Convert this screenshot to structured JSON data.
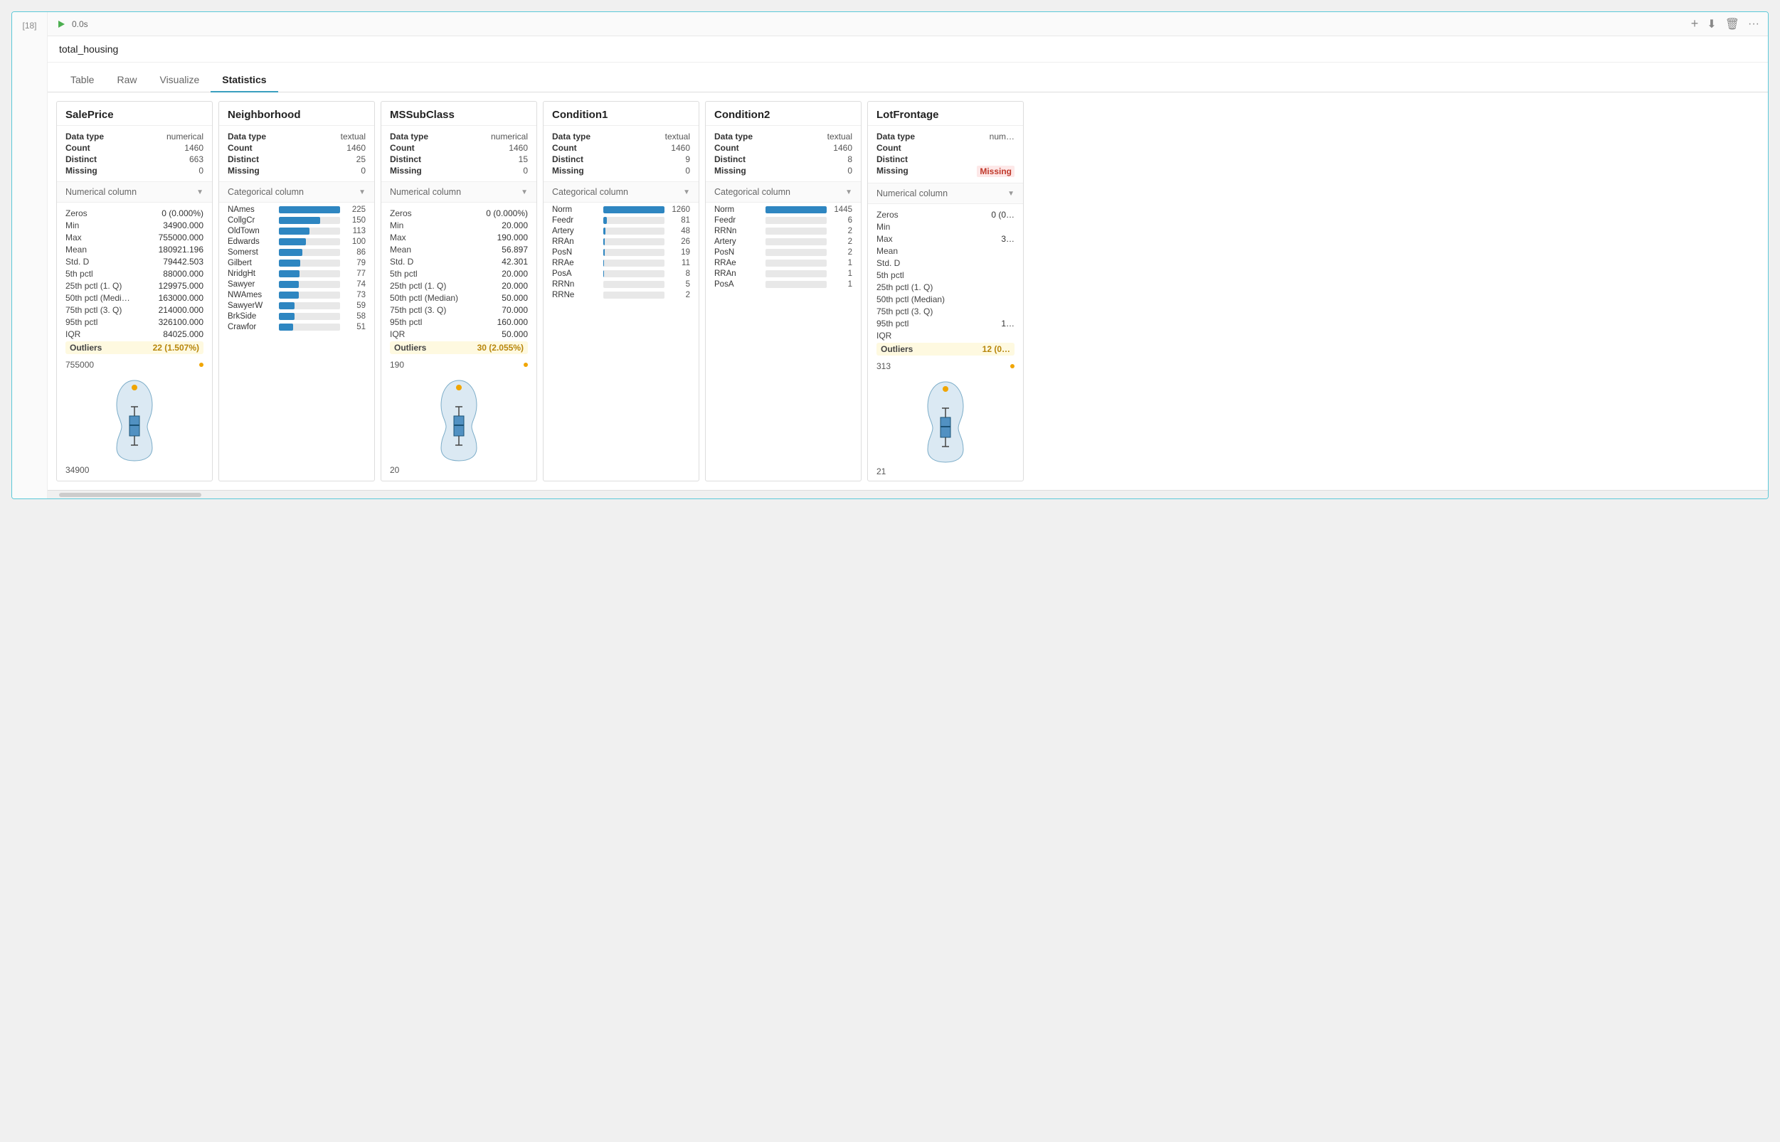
{
  "cell": {
    "number": "[18]",
    "run_time": "0.0s",
    "title": "total_housing",
    "actions": [
      "+",
      "⬇",
      "🗑",
      "···"
    ]
  },
  "tabs": [
    {
      "label": "Table",
      "active": false
    },
    {
      "label": "Raw",
      "active": false
    },
    {
      "label": "Visualize",
      "active": false
    },
    {
      "label": "Statistics",
      "active": true
    }
  ],
  "columns": [
    {
      "name": "SalePrice",
      "type": "numerical",
      "type_label": "Numerical column",
      "meta": {
        "Data type": "numerical",
        "Count": "1460",
        "Distinct": "663",
        "Missing": "0"
      },
      "stats": [
        {
          "label": "Zeros",
          "value": "0 (0.000%)"
        },
        {
          "label": "Min",
          "value": "34900.000"
        },
        {
          "label": "Max",
          "value": "755000.000"
        },
        {
          "label": "Mean",
          "value": "180921.196"
        },
        {
          "label": "Std. D",
          "value": "79442.503"
        },
        {
          "label": "5th pctl",
          "value": "88000.000"
        },
        {
          "label": "25th pctl (1. Q)",
          "value": "129975.000"
        },
        {
          "label": "50th pctl (Medi…",
          "value": "163000.000"
        },
        {
          "label": "75th pctl (3. Q)",
          "value": "214000.000"
        },
        {
          "label": "95th pctl",
          "value": "326100.000"
        },
        {
          "label": "IQR",
          "value": "84025.000"
        }
      ],
      "outliers": {
        "label": "Outliers",
        "value": "22 (1.507%)"
      },
      "violin_min": "34900",
      "violin_max": "755000",
      "missing_highlight": false
    },
    {
      "name": "Neighborhood",
      "type": "textual",
      "type_label": "Categorical column",
      "meta": {
        "Data type": "textual",
        "Count": "1460",
        "Distinct": "25",
        "Missing": "0"
      },
      "bars": [
        {
          "label": "NAmes",
          "count": 225,
          "max": 225
        },
        {
          "label": "CollgCr",
          "count": 150,
          "max": 225
        },
        {
          "label": "OldTown",
          "count": 113,
          "max": 225
        },
        {
          "label": "Edwards",
          "count": 100,
          "max": 225
        },
        {
          "label": "Somerst",
          "count": 86,
          "max": 225
        },
        {
          "label": "Gilbert",
          "count": 79,
          "max": 225
        },
        {
          "label": "NridgHt",
          "count": 77,
          "max": 225
        },
        {
          "label": "Sawyer",
          "count": 74,
          "max": 225
        },
        {
          "label": "NWAmes",
          "count": 73,
          "max": 225
        },
        {
          "label": "SawyerW",
          "count": 59,
          "max": 225
        },
        {
          "label": "BrkSide",
          "count": 58,
          "max": 225
        },
        {
          "label": "Crawfor",
          "count": 51,
          "max": 225
        }
      ],
      "missing_highlight": false
    },
    {
      "name": "MSSubClass",
      "type": "numerical",
      "type_label": "Numerical column",
      "meta": {
        "Data type": "numerical",
        "Count": "1460",
        "Distinct": "15",
        "Missing": "0"
      },
      "stats": [
        {
          "label": "Zeros",
          "value": "0 (0.000%)"
        },
        {
          "label": "Min",
          "value": "20.000"
        },
        {
          "label": "Max",
          "value": "190.000"
        },
        {
          "label": "Mean",
          "value": "56.897"
        },
        {
          "label": "Std. D",
          "value": "42.301"
        },
        {
          "label": "5th pctl",
          "value": "20.000"
        },
        {
          "label": "25th pctl (1. Q)",
          "value": "20.000"
        },
        {
          "label": "50th pctl (Median)",
          "value": "50.000"
        },
        {
          "label": "75th pctl (3. Q)",
          "value": "70.000"
        },
        {
          "label": "95th pctl",
          "value": "160.000"
        },
        {
          "label": "IQR",
          "value": "50.000"
        }
      ],
      "outliers": {
        "label": "Outliers",
        "value": "30 (2.055%)"
      },
      "violin_min": "20",
      "violin_max": "190",
      "missing_highlight": false
    },
    {
      "name": "Condition1",
      "type": "textual",
      "type_label": "Categorical column",
      "meta": {
        "Data type": "textual",
        "Count": "1460",
        "Distinct": "9",
        "Missing": "0"
      },
      "bars": [
        {
          "label": "Norm",
          "count": 1260,
          "max": 1260
        },
        {
          "label": "Feedr",
          "count": 81,
          "max": 1260
        },
        {
          "label": "Artery",
          "count": 48,
          "max": 1260
        },
        {
          "label": "RRAn",
          "count": 26,
          "max": 1260
        },
        {
          "label": "PosN",
          "count": 19,
          "max": 1260
        },
        {
          "label": "RRAe",
          "count": 11,
          "max": 1260
        },
        {
          "label": "PosA",
          "count": 8,
          "max": 1260
        },
        {
          "label": "RRNn",
          "count": 5,
          "max": 1260
        },
        {
          "label": "RRNe",
          "count": 2,
          "max": 1260
        }
      ],
      "missing_highlight": false
    },
    {
      "name": "Condition2",
      "type": "textual",
      "type_label": "Categorical column",
      "meta": {
        "Data type": "textual",
        "Count": "1460",
        "Distinct": "8",
        "Missing": "0"
      },
      "bars": [
        {
          "label": "Norm",
          "count": 1445,
          "max": 1445
        },
        {
          "label": "Feedr",
          "count": 6,
          "max": 1445
        },
        {
          "label": "RRNn",
          "count": 2,
          "max": 1445
        },
        {
          "label": "Artery",
          "count": 2,
          "max": 1445
        },
        {
          "label": "PosN",
          "count": 2,
          "max": 1445
        },
        {
          "label": "RRAe",
          "count": 1,
          "max": 1445
        },
        {
          "label": "RRAn",
          "count": 1,
          "max": 1445
        },
        {
          "label": "PosA",
          "count": 1,
          "max": 1445
        }
      ],
      "missing_highlight": false
    },
    {
      "name": "LotFrontage",
      "type": "numerical",
      "type_label": "Numerical column",
      "meta": {
        "Data type": "num…",
        "Count": "",
        "Distinct": "",
        "Missing": "highlight"
      },
      "stats": [
        {
          "label": "Zeros",
          "value": "0 (0…"
        },
        {
          "label": "Min",
          "value": ""
        },
        {
          "label": "Max",
          "value": "3…"
        },
        {
          "label": "Mean",
          "value": ""
        },
        {
          "label": "Std. D",
          "value": ""
        },
        {
          "label": "5th pctl",
          "value": ""
        },
        {
          "label": "25th pctl (1. Q)",
          "value": ""
        },
        {
          "label": "50th pctl (Median)",
          "value": ""
        },
        {
          "label": "75th pctl (3. Q)",
          "value": ""
        },
        {
          "label": "95th pctl",
          "value": "1…"
        },
        {
          "label": "IQR",
          "value": ""
        }
      ],
      "outliers": {
        "label": "Outliers",
        "value": "12 (0…"
      },
      "violin_min": "21",
      "violin_max": "313",
      "missing_highlight": true
    }
  ]
}
